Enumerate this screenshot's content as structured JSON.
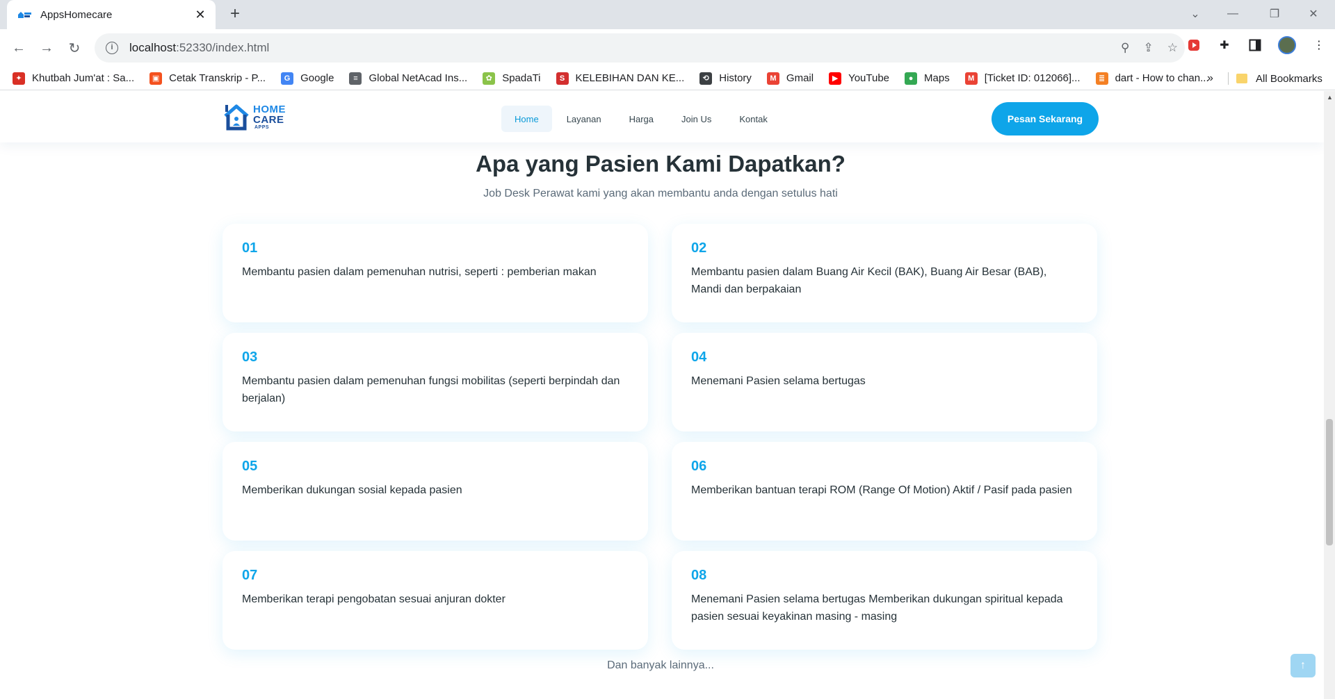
{
  "browser": {
    "tab_title": "AppsHomecare",
    "url_host": "localhost",
    "url_path": ":52330/index.html",
    "bookmarks": [
      {
        "label": "Khutbah Jum'at : Sa...",
        "icon": "bookmark-khutbah-icon",
        "color": "#d93025"
      },
      {
        "label": "Cetak Transkrip - P...",
        "icon": "bookmark-cetak-icon",
        "color": "#f4511e"
      },
      {
        "label": "Google",
        "icon": "google-icon",
        "color": "#4285f4"
      },
      {
        "label": "Global NetAcad Ins...",
        "icon": "cisco-icon",
        "color": "#5f6368"
      },
      {
        "label": "SpadaTi",
        "icon": "spadati-icon",
        "color": "#8bc34a"
      },
      {
        "label": "KELEBIHAN DAN KE...",
        "icon": "s-logo-icon",
        "color": "#d32f2f"
      },
      {
        "label": "History",
        "icon": "history-icon",
        "color": "#3c4043"
      },
      {
        "label": "Gmail",
        "icon": "gmail-icon",
        "color": "#ea4335"
      },
      {
        "label": "YouTube",
        "icon": "youtube-icon",
        "color": "#ff0000"
      },
      {
        "label": "Maps",
        "icon": "maps-icon",
        "color": "#34a853"
      },
      {
        "label": "[Ticket ID: 012066]...",
        "icon": "gmail-icon",
        "color": "#ea4335"
      },
      {
        "label": "dart - How to chan...",
        "icon": "stackoverflow-icon",
        "color": "#f48024"
      }
    ],
    "bookmarks_overflow": "»",
    "all_bookmarks": "All Bookmarks"
  },
  "site": {
    "logo": {
      "line1": "HOME",
      "line2": "CARE",
      "line3": "APPS"
    },
    "menu": [
      {
        "label": "Home",
        "active": true
      },
      {
        "label": "Layanan",
        "active": false
      },
      {
        "label": "Harga",
        "active": false
      },
      {
        "label": "Join Us",
        "active": false
      },
      {
        "label": "Kontak",
        "active": false
      }
    ],
    "cta": "Pesan Sekarang",
    "accent_color": "#0ea5e9"
  },
  "section": {
    "title": "Apa yang Pasien Kami Dapatkan?",
    "subtitle": "Job Desk Perawat kami yang akan membantu anda dengan setulus hati",
    "items": [
      {
        "num": "01",
        "text": "Membantu pasien dalam pemenuhan nutrisi, seperti : pemberian makan"
      },
      {
        "num": "02",
        "text": "Membantu pasien dalam Buang Air Kecil (BAK), Buang Air Besar (BAB), Mandi dan berpakaian"
      },
      {
        "num": "03",
        "text": "Membantu pasien dalam pemenuhan fungsi mobilitas (seperti berpindah dan berjalan)"
      },
      {
        "num": "04",
        "text": "Menemani Pasien selama bertugas"
      },
      {
        "num": "05",
        "text": "Memberikan dukungan sosial kepada pasien"
      },
      {
        "num": "06",
        "text": "Memberikan bantuan terapi ROM (Range Of Motion) Aktif / Pasif pada pasien"
      },
      {
        "num": "07",
        "text": "Memberikan terapi pengobatan sesuai anjuran dokter"
      },
      {
        "num": "08",
        "text": "Menemani Pasien selama bertugas Memberikan dukungan spiritual kepada pasien sesuai keyakinan masing - masing"
      }
    ],
    "more": "Dan banyak lainnya..."
  }
}
